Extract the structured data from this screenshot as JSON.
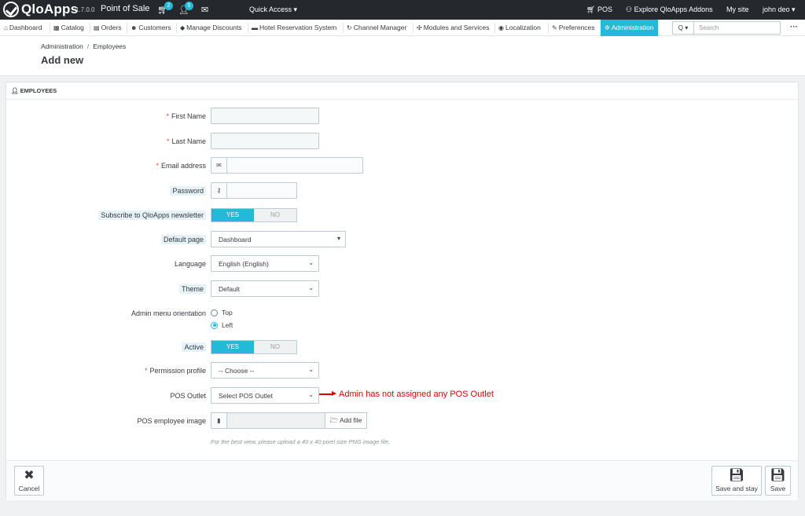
{
  "header": {
    "brand": "QloApps",
    "version": "1.7.0.0",
    "shop_name": "Point of Sale",
    "cart_badge": "2",
    "customers_badge": "5",
    "quick_access": "Quick Access ▾",
    "pos": "POS",
    "explore": "Explore QloApps Addons",
    "my_site": "My site",
    "user": "john deo ▾"
  },
  "nav": {
    "items": [
      {
        "icon": "⌂",
        "label": "Dashboard"
      },
      {
        "icon": "▦",
        "label": "Catalog"
      },
      {
        "icon": "▤",
        "label": "Orders"
      },
      {
        "icon": "☻",
        "label": "Customers"
      },
      {
        "icon": "◆",
        "label": "Manage Discounts"
      },
      {
        "icon": "▬",
        "label": "Hotel Reservation System"
      },
      {
        "icon": "↻",
        "label": "Channel Manager"
      },
      {
        "icon": "✣",
        "label": "Modules and Services"
      },
      {
        "icon": "◉",
        "label": "Localization"
      },
      {
        "icon": "✎",
        "label": "Preferences"
      },
      {
        "icon": "✲",
        "label": "Administration"
      }
    ],
    "search_placeholder": "Search",
    "search_button": "Q ▾",
    "more": "···"
  },
  "page": {
    "breadcrumb_parent": "Administration",
    "breadcrumb_sep": "/",
    "breadcrumb_current": "Employees",
    "title": "Add new"
  },
  "form": {
    "heading": "EMPLOYEES",
    "heading_icon": "user-icon",
    "required_mark": "*",
    "first_name_label": "First Name",
    "first_name_value": "",
    "last_name_label": "Last Name",
    "last_name_value": "",
    "email_label": "Email address",
    "email_value": "",
    "password_label": "Password",
    "password_value": "",
    "newsletter_label": "Subscribe to QloApps newsletter",
    "yes": "YES",
    "no": "NO",
    "default_page_label": "Default page",
    "default_page_value": "Dashboard",
    "language_label": "Language",
    "language_value": "English (English)",
    "theme_label": "Theme",
    "theme_value": "Default",
    "menu_orientation_label": "Admin menu orientation",
    "orientation_top": "Top",
    "orientation_left": "Left",
    "active_label": "Active",
    "permission_label": "Permission profile",
    "permission_value": "-- Choose --",
    "pos_outlet_label": "POS Outlet",
    "pos_outlet_value": "Select POS Outlet",
    "annotation": "Admin has not assigned any POS Outlet",
    "pos_image_label": "POS employee image",
    "add_file": "Add file",
    "help_text": "For the best view, please upload a 40 x 40 pixel size PNG image file."
  },
  "footer": {
    "cancel": "Cancel",
    "save_and_stay": "Save and stay",
    "save": "Save"
  },
  "colors": {
    "accent": "#25b9d7",
    "header_bg": "#25292d",
    "annotation": "#e00000",
    "required": "#e84e31"
  }
}
